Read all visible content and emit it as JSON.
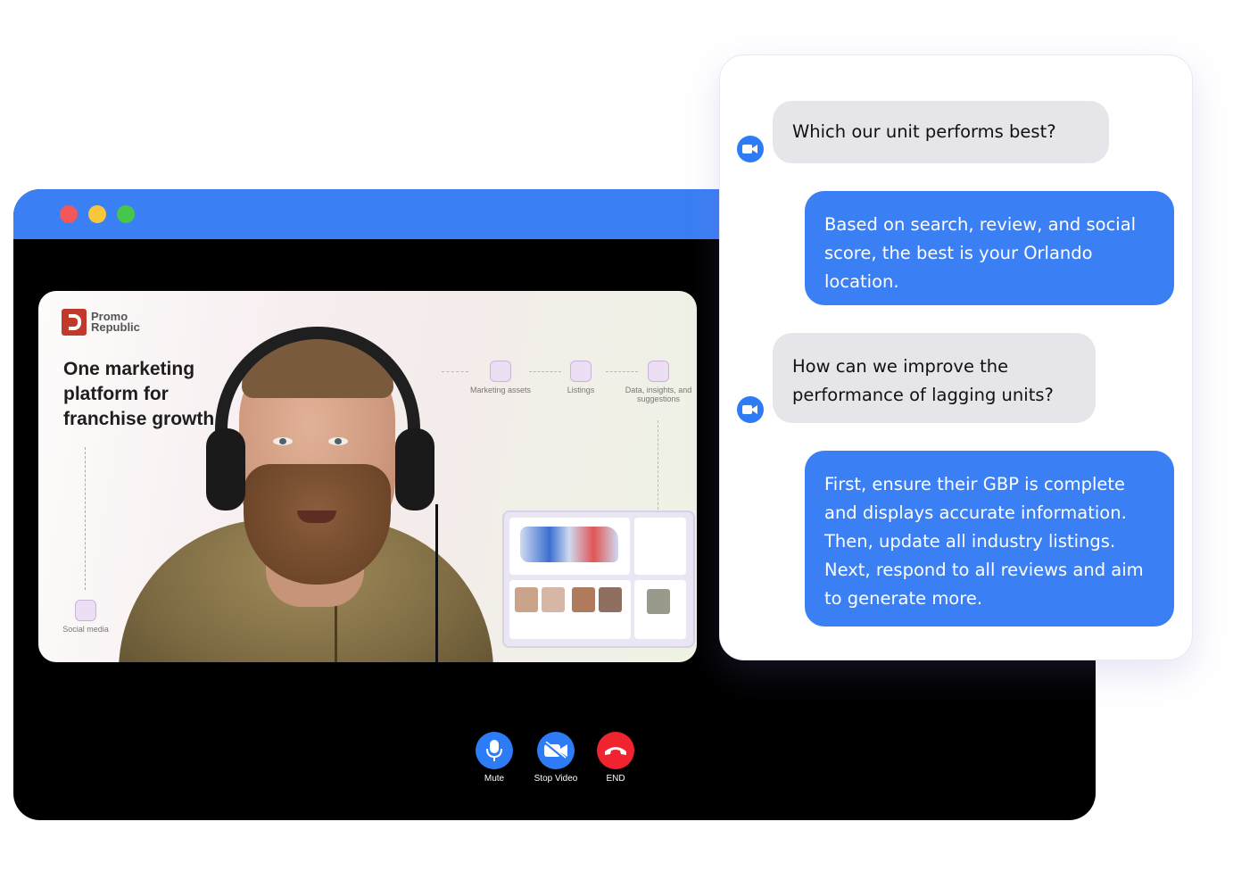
{
  "window": {
    "title_dots": [
      "close",
      "minimize",
      "maximize"
    ],
    "titlebar_color": "#3b7ff5"
  },
  "slide": {
    "brand": "Promo Republic",
    "headline": "One marketing platform for franchise growth",
    "nodes": {
      "marketing_assets": "Marketing assets",
      "listings": "Listings",
      "data": "Data, insights, and suggestions",
      "social_media": "Social media"
    }
  },
  "controls": {
    "mute_label": "Mute",
    "stop_video_label": "Stop Video",
    "end_label": "END",
    "mute_icon": "microphone-icon",
    "video_icon": "video-camera-off-icon",
    "end_icon": "phone-hangup-icon"
  },
  "chat": {
    "messages": [
      {
        "role": "user",
        "text": "Which our unit performs best?"
      },
      {
        "role": "assistant",
        "text": "Based on search, review, and social score, the best is your Orlando location."
      },
      {
        "role": "user",
        "text": "How can we improve the performance of lagging units?"
      },
      {
        "role": "assistant",
        "text": "First, ensure their GBP is complete and displays accurate information. Then, update all industry listings. Next, respond to all reviews and aim to generate more."
      }
    ],
    "user_bubble_color": "#e6e6ea",
    "assistant_bubble_color": "#3b7ff5"
  },
  "colors": {
    "accent": "#2d7cf6",
    "end_call": "#f0242e",
    "dot_red": "#f2575a",
    "dot_yellow": "#f8c63a",
    "dot_green": "#46c64a"
  }
}
